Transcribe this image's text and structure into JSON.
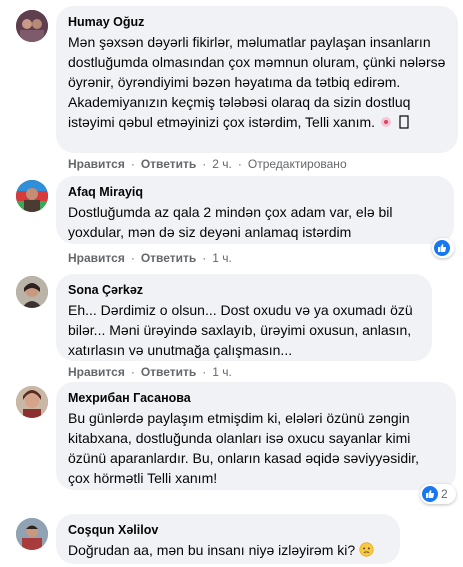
{
  "labels": {
    "like": "Нравится",
    "reply": "Ответить",
    "separator": "·"
  },
  "comments": [
    {
      "author": "Humay Oğuz",
      "paragraphs": [
        "Mən şəxsən dəyərli fikirlər, məlumatlar paylaşan insanların dostluğumda olmasından çox məmnun oluram, çünki nələrsə öyrənir, öyrəndiyimi bəzən həyatıma da tətbiq edirəm.",
        "Akademiyanızın keçmiş tələbəsi olaraq da sizin dostluq istəyimi qəbul etməyinizi çox istərdim, Telli xanım."
      ],
      "time": "2 ч.",
      "edited": "Отредактировано"
    },
    {
      "author": "Afaq Mirayiq",
      "paragraphs": [
        "Dostluğumda az qala 2 mindən çox adam var, elə bil yoxdular, mən də siz deyəni anlamaq istərdim"
      ],
      "time": "1 ч."
    },
    {
      "author": "Sona Çərkəz",
      "paragraphs": [
        "Eh... Dərdimiz o olsun... Dost oxudu və ya oxumadı özü bilər... Məni ürəyində saxlayıb, ürəyimi oxusun, anlasın, xatırlasın və unutmağa çalışmasın..."
      ],
      "time": "1 ч."
    },
    {
      "author": "Мехрибан Гасанова",
      "paragraphs": [
        "Bu günlərdə paylaşım etmişdim ki, elələri özünü zəngin kitabxana, dostluğunda olanları isə oxucu sayanlar kimi özünü aparanlardır. Bu, onların kasad əqidə səviyyəsidir, çox hörmətli Telli xanım!"
      ],
      "time": "1 ч.",
      "reaction_count": "2"
    },
    {
      "author": "Coşqun Xəlilov",
      "paragraphs": [
        "Doğrudan aa, mən bu insanı niyə izləyirəm ki?"
      ]
    }
  ],
  "colors": {
    "bubble": "#f0f2f5",
    "meta": "#65676b",
    "like_blue": "#1877f2"
  }
}
